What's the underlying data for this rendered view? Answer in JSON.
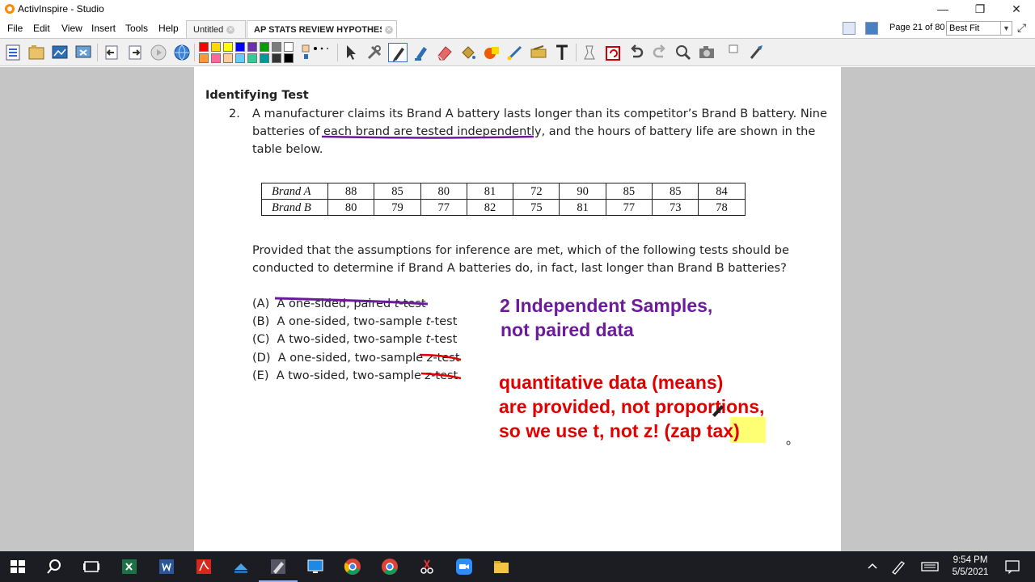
{
  "window": {
    "title": "ActivInspire - Studio"
  },
  "menu": [
    "File",
    "Edit",
    "View",
    "Insert",
    "Tools",
    "Help"
  ],
  "tabs": [
    {
      "label": "Untitled"
    },
    {
      "label": "AP STATS REVIEW HYPOTHESIS"
    }
  ],
  "page_counter": "Page 21 of 80",
  "zoom": {
    "selected": "Best Fit"
  },
  "palette_colors": [
    "#ff0000",
    "#ffd800",
    "#ffff00",
    "#0000ff",
    "#6b2fae",
    "#00a000",
    "#7c7c7c",
    "#ffffff",
    "#ff9933",
    "#ff6699",
    "#ffcc99",
    "#66ccff",
    "#33cc99",
    "#009999",
    "#333333",
    "#000000"
  ],
  "document": {
    "heading": "Identifying Test",
    "question_number": "2.",
    "question_lines": [
      "A manufacturer claims its Brand A battery lasts longer than its competitor’s Brand B battery. Nine",
      "batteries of each brand are tested independently, and the hours of battery life are shown in the",
      "table below."
    ],
    "table": {
      "rows": [
        {
          "label": "Brand A",
          "values": [
            "88",
            "85",
            "80",
            "81",
            "72",
            "90",
            "85",
            "85",
            "84"
          ]
        },
        {
          "label": "Brand B",
          "values": [
            "80",
            "79",
            "77",
            "82",
            "75",
            "81",
            "77",
            "73",
            "78"
          ]
        }
      ]
    },
    "prompt_lines": [
      "Provided that the assumptions for inference are met, which of the following tests should be",
      "conducted to determine if Brand A batteries do, in fact, last longer than Brand B batteries?"
    ],
    "choices": [
      {
        "letter": "(A)",
        "pre": "A one-sided, paired ",
        "var": "t",
        "post": "-test"
      },
      {
        "letter": "(B)",
        "pre": "A one-sided, two-sample ",
        "var": "t",
        "post": "-test"
      },
      {
        "letter": "(C)",
        "pre": "A two-sided, two-sample ",
        "var": "t",
        "post": "-test"
      },
      {
        "letter": "(D)",
        "pre": "A one-sided, two-sample ",
        "var": "z",
        "post": "-test"
      },
      {
        "letter": "(E)",
        "pre": "A two-sided, two-sample ",
        "var": "z",
        "post": "-test"
      }
    ]
  },
  "annotations": {
    "purple_lines": [
      "2 Independent Samples,",
      "not paired data"
    ],
    "red_lines": [
      "quantitative data (means)",
      "are provided, not proportions,",
      "so we use t, not z!  (zap tax)"
    ],
    "purple_color": "#6b1b9b",
    "red_color": "#e00000"
  },
  "taskbar": {
    "time": "9:54 PM",
    "date": "5/5/2021"
  }
}
